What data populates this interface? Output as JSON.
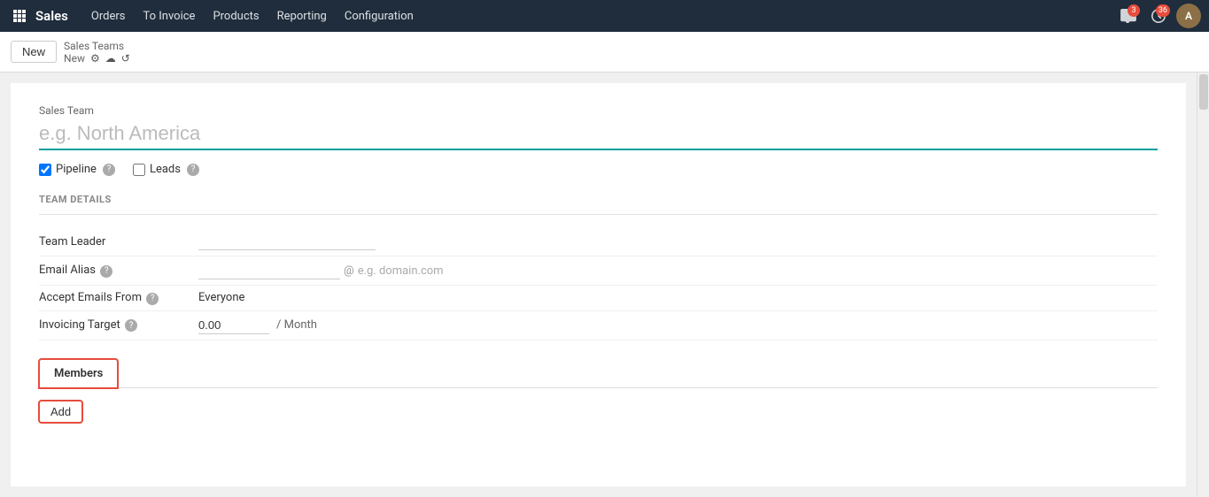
{
  "nav": {
    "app_name": "Sales",
    "menu_items": [
      "Orders",
      "To Invoice",
      "Products",
      "Reporting",
      "Configuration"
    ],
    "badge_messages": "3",
    "badge_clock": "36",
    "avatar_initials": "A"
  },
  "toolbar": {
    "new_button_label": "New",
    "breadcrumb_parent": "Sales Teams",
    "breadcrumb_current": "New",
    "settings_icon": "⚙",
    "cloud_icon": "☁",
    "undo_icon": "↺"
  },
  "form": {
    "sales_team_label": "Sales Team",
    "sales_team_placeholder": "e.g. North America",
    "pipeline_label": "Pipeline",
    "pipeline_checked": true,
    "leads_label": "Leads",
    "leads_checked": false,
    "help_icon": "?",
    "section_title": "TEAM DETAILS",
    "team_leader_label": "Team Leader",
    "email_alias_label": "Email Alias",
    "email_alias_help": "?",
    "email_at": "@",
    "email_domain_placeholder": "e.g. domain.com",
    "accept_emails_label": "Accept Emails From",
    "accept_emails_help": "?",
    "accept_emails_value": "Everyone",
    "invoicing_target_label": "Invoicing Target",
    "invoicing_target_help": "?",
    "invoicing_value": "0.00",
    "per_month": "/ Month",
    "tab_members_label": "Members",
    "add_button_label": "Add"
  }
}
